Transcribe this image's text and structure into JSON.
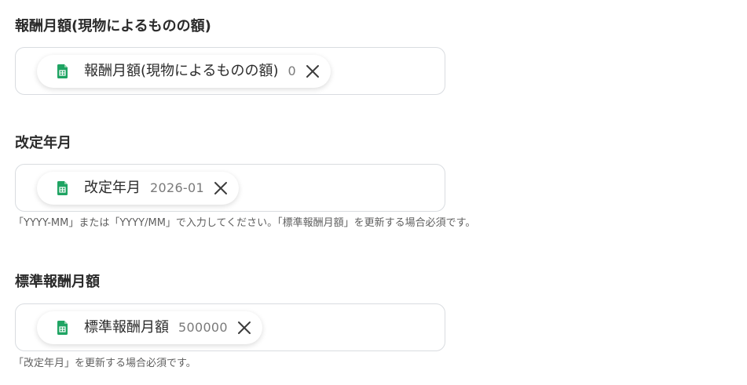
{
  "fields": [
    {
      "label": "報酬月額(現物によるものの額)",
      "chip": {
        "icon": "google-sheets-icon",
        "name": "報酬月額(現物によるものの額)",
        "value": "0"
      },
      "help": ""
    },
    {
      "label": "改定年月",
      "chip": {
        "icon": "google-sheets-icon",
        "name": "改定年月",
        "value": "2026-01"
      },
      "help": "「YYYY-MM」または「YYYY/MM」で入力してください。「標準報酬月額」を更新する場合必須です。"
    },
    {
      "label": "標準報酬月額",
      "chip": {
        "icon": "google-sheets-icon",
        "name": "標準報酬月額",
        "value": "500000"
      },
      "help": "「改定年月」を更新する場合必須です。"
    }
  ],
  "colors": {
    "sheets_green": "#1fa463",
    "border": "#d9dce0",
    "text": "#2b2b2b",
    "muted": "#7a7a7a"
  }
}
